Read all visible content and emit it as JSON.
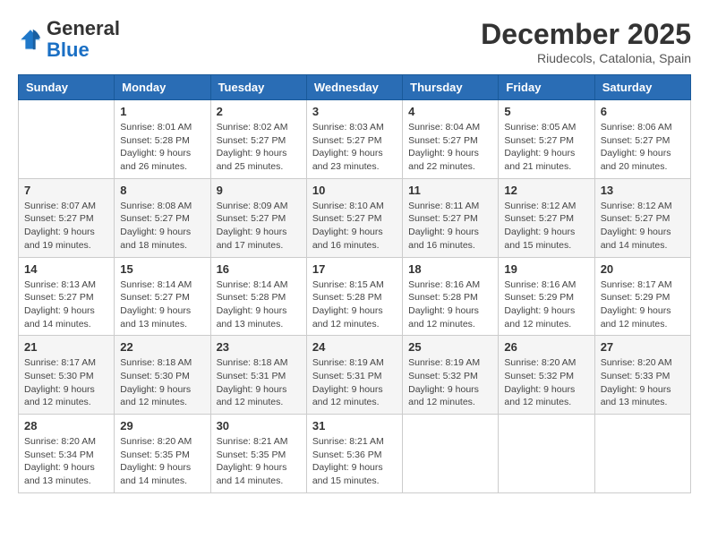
{
  "header": {
    "logo_general": "General",
    "logo_blue": "Blue",
    "month_year": "December 2025",
    "location": "Riudecols, Catalonia, Spain"
  },
  "days_of_week": [
    "Sunday",
    "Monday",
    "Tuesday",
    "Wednesday",
    "Thursday",
    "Friday",
    "Saturday"
  ],
  "weeks": [
    [
      {
        "day": "",
        "sunrise": "",
        "sunset": "",
        "daylight": ""
      },
      {
        "day": "1",
        "sunrise": "Sunrise: 8:01 AM",
        "sunset": "Sunset: 5:28 PM",
        "daylight": "Daylight: 9 hours and 26 minutes."
      },
      {
        "day": "2",
        "sunrise": "Sunrise: 8:02 AM",
        "sunset": "Sunset: 5:27 PM",
        "daylight": "Daylight: 9 hours and 25 minutes."
      },
      {
        "day": "3",
        "sunrise": "Sunrise: 8:03 AM",
        "sunset": "Sunset: 5:27 PM",
        "daylight": "Daylight: 9 hours and 23 minutes."
      },
      {
        "day": "4",
        "sunrise": "Sunrise: 8:04 AM",
        "sunset": "Sunset: 5:27 PM",
        "daylight": "Daylight: 9 hours and 22 minutes."
      },
      {
        "day": "5",
        "sunrise": "Sunrise: 8:05 AM",
        "sunset": "Sunset: 5:27 PM",
        "daylight": "Daylight: 9 hours and 21 minutes."
      },
      {
        "day": "6",
        "sunrise": "Sunrise: 8:06 AM",
        "sunset": "Sunset: 5:27 PM",
        "daylight": "Daylight: 9 hours and 20 minutes."
      }
    ],
    [
      {
        "day": "7",
        "sunrise": "Sunrise: 8:07 AM",
        "sunset": "Sunset: 5:27 PM",
        "daylight": "Daylight: 9 hours and 19 minutes."
      },
      {
        "day": "8",
        "sunrise": "Sunrise: 8:08 AM",
        "sunset": "Sunset: 5:27 PM",
        "daylight": "Daylight: 9 hours and 18 minutes."
      },
      {
        "day": "9",
        "sunrise": "Sunrise: 8:09 AM",
        "sunset": "Sunset: 5:27 PM",
        "daylight": "Daylight: 9 hours and 17 minutes."
      },
      {
        "day": "10",
        "sunrise": "Sunrise: 8:10 AM",
        "sunset": "Sunset: 5:27 PM",
        "daylight": "Daylight: 9 hours and 16 minutes."
      },
      {
        "day": "11",
        "sunrise": "Sunrise: 8:11 AM",
        "sunset": "Sunset: 5:27 PM",
        "daylight": "Daylight: 9 hours and 16 minutes."
      },
      {
        "day": "12",
        "sunrise": "Sunrise: 8:12 AM",
        "sunset": "Sunset: 5:27 PM",
        "daylight": "Daylight: 9 hours and 15 minutes."
      },
      {
        "day": "13",
        "sunrise": "Sunrise: 8:12 AM",
        "sunset": "Sunset: 5:27 PM",
        "daylight": "Daylight: 9 hours and 14 minutes."
      }
    ],
    [
      {
        "day": "14",
        "sunrise": "Sunrise: 8:13 AM",
        "sunset": "Sunset: 5:27 PM",
        "daylight": "Daylight: 9 hours and 14 minutes."
      },
      {
        "day": "15",
        "sunrise": "Sunrise: 8:14 AM",
        "sunset": "Sunset: 5:27 PM",
        "daylight": "Daylight: 9 hours and 13 minutes."
      },
      {
        "day": "16",
        "sunrise": "Sunrise: 8:14 AM",
        "sunset": "Sunset: 5:28 PM",
        "daylight": "Daylight: 9 hours and 13 minutes."
      },
      {
        "day": "17",
        "sunrise": "Sunrise: 8:15 AM",
        "sunset": "Sunset: 5:28 PM",
        "daylight": "Daylight: 9 hours and 12 minutes."
      },
      {
        "day": "18",
        "sunrise": "Sunrise: 8:16 AM",
        "sunset": "Sunset: 5:28 PM",
        "daylight": "Daylight: 9 hours and 12 minutes."
      },
      {
        "day": "19",
        "sunrise": "Sunrise: 8:16 AM",
        "sunset": "Sunset: 5:29 PM",
        "daylight": "Daylight: 9 hours and 12 minutes."
      },
      {
        "day": "20",
        "sunrise": "Sunrise: 8:17 AM",
        "sunset": "Sunset: 5:29 PM",
        "daylight": "Daylight: 9 hours and 12 minutes."
      }
    ],
    [
      {
        "day": "21",
        "sunrise": "Sunrise: 8:17 AM",
        "sunset": "Sunset: 5:30 PM",
        "daylight": "Daylight: 9 hours and 12 minutes."
      },
      {
        "day": "22",
        "sunrise": "Sunrise: 8:18 AM",
        "sunset": "Sunset: 5:30 PM",
        "daylight": "Daylight: 9 hours and 12 minutes."
      },
      {
        "day": "23",
        "sunrise": "Sunrise: 8:18 AM",
        "sunset": "Sunset: 5:31 PM",
        "daylight": "Daylight: 9 hours and 12 minutes."
      },
      {
        "day": "24",
        "sunrise": "Sunrise: 8:19 AM",
        "sunset": "Sunset: 5:31 PM",
        "daylight": "Daylight: 9 hours and 12 minutes."
      },
      {
        "day": "25",
        "sunrise": "Sunrise: 8:19 AM",
        "sunset": "Sunset: 5:32 PM",
        "daylight": "Daylight: 9 hours and 12 minutes."
      },
      {
        "day": "26",
        "sunrise": "Sunrise: 8:20 AM",
        "sunset": "Sunset: 5:32 PM",
        "daylight": "Daylight: 9 hours and 12 minutes."
      },
      {
        "day": "27",
        "sunrise": "Sunrise: 8:20 AM",
        "sunset": "Sunset: 5:33 PM",
        "daylight": "Daylight: 9 hours and 13 minutes."
      }
    ],
    [
      {
        "day": "28",
        "sunrise": "Sunrise: 8:20 AM",
        "sunset": "Sunset: 5:34 PM",
        "daylight": "Daylight: 9 hours and 13 minutes."
      },
      {
        "day": "29",
        "sunrise": "Sunrise: 8:20 AM",
        "sunset": "Sunset: 5:35 PM",
        "daylight": "Daylight: 9 hours and 14 minutes."
      },
      {
        "day": "30",
        "sunrise": "Sunrise: 8:21 AM",
        "sunset": "Sunset: 5:35 PM",
        "daylight": "Daylight: 9 hours and 14 minutes."
      },
      {
        "day": "31",
        "sunrise": "Sunrise: 8:21 AM",
        "sunset": "Sunset: 5:36 PM",
        "daylight": "Daylight: 9 hours and 15 minutes."
      },
      {
        "day": "",
        "sunrise": "",
        "sunset": "",
        "daylight": ""
      },
      {
        "day": "",
        "sunrise": "",
        "sunset": "",
        "daylight": ""
      },
      {
        "day": "",
        "sunrise": "",
        "sunset": "",
        "daylight": ""
      }
    ]
  ]
}
